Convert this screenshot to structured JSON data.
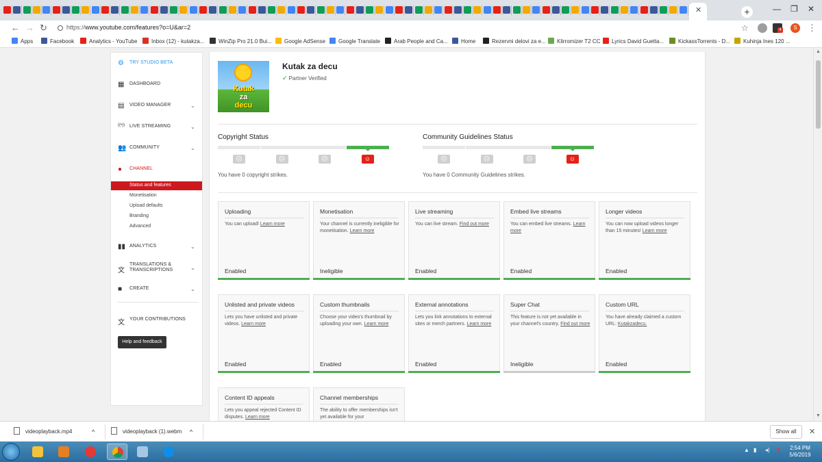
{
  "browser": {
    "url_prefix": "https://",
    "url_rest": "www.youtube.com/features?o=U&ar=2",
    "bookmarks": [
      {
        "label": "Apps",
        "icon": "apps-grid-icon",
        "color": "#4285f4"
      },
      {
        "label": "Facebook",
        "icon": "facebook-icon",
        "color": "#3b5998"
      },
      {
        "label": "Analytics - YouTube",
        "icon": "youtube-icon",
        "color": "#e62117"
      },
      {
        "label": "Inbox (12) - kutakza...",
        "icon": "gmail-icon",
        "color": "#d93025"
      },
      {
        "label": "WinZip Pro 21.0 Bui...",
        "icon": "winzip-icon",
        "color": "#333333"
      },
      {
        "label": "Google AdSense",
        "icon": "adsense-icon",
        "color": "#fbbc04"
      },
      {
        "label": "Google Translate",
        "icon": "translate-icon",
        "color": "#4285f4"
      },
      {
        "label": "Arab People and Ca...",
        "icon": "page-icon",
        "color": "#222222"
      },
      {
        "label": "Home",
        "icon": "facebook-icon",
        "color": "#3b5998"
      },
      {
        "label": "Rezervni delovi za e...",
        "icon": "page-icon",
        "color": "#222222"
      },
      {
        "label": "Klirromizer T2 CC",
        "icon": "page-icon",
        "color": "#6aa84f"
      },
      {
        "label": "Lyrics David Guetta...",
        "icon": "youtube-icon",
        "color": "#e62117"
      },
      {
        "label": "KickassTorrents - D...",
        "icon": "kickass-icon",
        "color": "#6b8e23"
      },
      {
        "label": "Kuhinja Ines 120 ...",
        "icon": "page-icon",
        "color": "#c9a400"
      }
    ],
    "avatar_letter": "S",
    "badge_count": "4"
  },
  "sidebar": {
    "top_items": [
      {
        "label": "TRY STUDIO BETA",
        "icon": "gear-icon",
        "color": "#2793e6"
      },
      {
        "label": "DASHBOARD",
        "icon": "dashboard-icon",
        "color": "#333333"
      },
      {
        "label": "VIDEO MANAGER",
        "icon": "video-manager-icon",
        "color": "#333333"
      },
      {
        "label": "LIVE STREAMING",
        "icon": "live-streaming-icon",
        "color": "#333333"
      },
      {
        "label": "COMMUNITY",
        "icon": "community-icon",
        "color": "#333333"
      },
      {
        "label": "CHANNEL",
        "icon": "channel-icon",
        "color": "#cc181e"
      }
    ],
    "channel_sub_items": [
      "Status and features",
      "Monetisation",
      "Upload defaults",
      "Branding",
      "Advanced"
    ],
    "bottom_items": [
      {
        "label": "ANALYTICS",
        "icon": "analytics-icon"
      },
      {
        "label": "TRANSLATIONS & TRANSCRIPTIONS",
        "icon": "translate-icon"
      },
      {
        "label": "CREATE",
        "icon": "create-icon"
      }
    ],
    "contributions": "YOUR CONTRIBUTIONS",
    "help": "Help and feedback"
  },
  "channel": {
    "name": "Kutak za decu",
    "verified": "Partner Verified",
    "thumb_lines": [
      "Kutak",
      "za",
      "decu"
    ]
  },
  "copyright": {
    "title": "Copyright Status",
    "text": "You have 0 copyright strikes.",
    "active_level": 4,
    "levels": 4
  },
  "community": {
    "title": "Community Guidelines Status",
    "text": "You have 0 Community Guidelines strikes.",
    "active_level": 4,
    "levels": 4
  },
  "features": [
    {
      "title": "Uploading",
      "desc": "You can upload!",
      "link": "Learn more",
      "status": "Enabled",
      "ok": true
    },
    {
      "title": "Monetisation",
      "desc": "Your channel is currently ineligible for monetisation.",
      "link": "Learn more",
      "status": "Ineligible",
      "ok": true
    },
    {
      "title": "Live streaming",
      "desc": "You can live stream.",
      "link": "Find out more",
      "status": "Enabled",
      "ok": true
    },
    {
      "title": "Embed live streams",
      "desc": "You can embed live streams.",
      "link": "Learn more",
      "status": "Enabled",
      "ok": true
    },
    {
      "title": "Longer videos",
      "desc": "You can now upload videos longer than 15 minutes!",
      "link": "Learn more",
      "status": "Enabled",
      "ok": true
    },
    {
      "title": "Unlisted and private videos",
      "desc": "Lets you have unlisted and private videos.",
      "link": "Learn more",
      "status": "Enabled",
      "ok": true
    },
    {
      "title": "Custom thumbnails",
      "desc": "Choose your video's thumbnail by uploading your own.",
      "link": "Learn more",
      "status": "Enabled",
      "ok": true
    },
    {
      "title": "External annotations",
      "desc": "Lets you link annotations to external sites or merch partners.",
      "link": "Learn more",
      "status": "Enabled",
      "ok": true
    },
    {
      "title": "Super Chat",
      "desc": "This feature is not yet available in your channel's country.",
      "link": "Find out more",
      "status": "Ineligible",
      "ok": false
    },
    {
      "title": "Custom URL",
      "desc": "You have already claimed a custom URL:",
      "link": "Kutakzadecu.",
      "status": "Enabled",
      "ok": true
    },
    {
      "title": "Content ID appeals",
      "desc": "Lets you appeal rejected Content ID disputes.",
      "link": "Learn more",
      "status": "",
      "ok": true
    },
    {
      "title": "Channel memberships",
      "desc": "The ability to offer memberships isn't yet available for your",
      "link": "",
      "status": "",
      "ok": true
    }
  ],
  "downloads": {
    "files": [
      "videoplayback.mp4",
      "videoplayback (1).webm"
    ],
    "show_all": "Show all"
  },
  "taskbar": {
    "time": "2:54 PM",
    "date": "5/6/2019"
  },
  "colors": {
    "accent_red": "#cc181e",
    "enabled_green": "#4caf50",
    "strike_red": "#e62117"
  }
}
